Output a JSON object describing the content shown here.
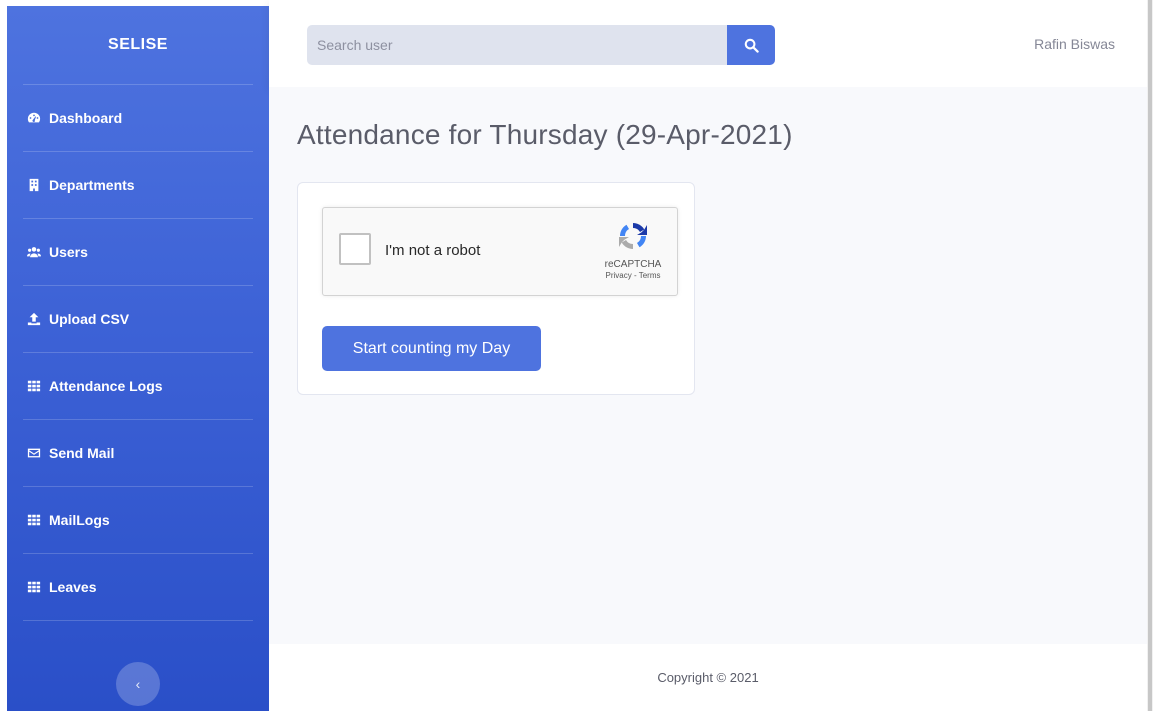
{
  "sidebar": {
    "brand": "SELISE",
    "items": [
      {
        "label": "Dashboard",
        "icon": "dashboard-icon"
      },
      {
        "label": "Departments",
        "icon": "building-icon"
      },
      {
        "label": "Users",
        "icon": "users-icon"
      },
      {
        "label": "Upload CSV",
        "icon": "upload-icon"
      },
      {
        "label": "Attendance Logs",
        "icon": "grid-icon"
      },
      {
        "label": "Send Mail",
        "icon": "envelope-icon"
      },
      {
        "label": "MailLogs",
        "icon": "grid-icon"
      },
      {
        "label": "Leaves",
        "icon": "grid-icon"
      }
    ],
    "toggle_glyph": "‹"
  },
  "topbar": {
    "search_placeholder": "Search user",
    "user_name": "Rafin Biswas"
  },
  "main": {
    "title": "Attendance for Thursday (29-Apr-2021)",
    "captcha": {
      "label": "I'm not a robot",
      "brand": "reCAPTCHA",
      "terms": "Privacy - Terms"
    },
    "start_button": "Start counting my Day"
  },
  "footer": {
    "copyright": "Copyright © 2021"
  },
  "colors": {
    "primary": "#4e73df",
    "sidebar_bottom": "#2a4fc8",
    "page_bg": "#f8f9fc",
    "text_muted": "#858796"
  }
}
